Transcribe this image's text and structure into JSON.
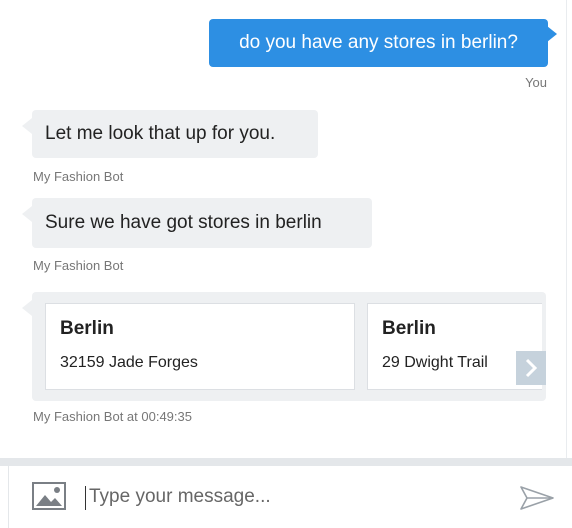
{
  "messages": {
    "user": {
      "text": "do you have any stores in berlin?",
      "sender": "You"
    },
    "bot1": {
      "text": "Let me look that up for you.",
      "sender": "My Fashion Bot"
    },
    "bot2": {
      "text": "Sure we have got stores in berlin",
      "sender": "My Fashion Bot"
    }
  },
  "carousel": {
    "cards": [
      {
        "title": "Berlin",
        "address": "32159 Jade Forges"
      },
      {
        "title": "Berlin",
        "address": "29 Dwight Trail"
      }
    ],
    "next_icon": "chevron-right-icon",
    "sender": "My Fashion Bot at 00:49:35"
  },
  "composer": {
    "placeholder": "Type your message...",
    "image_icon": "image-icon",
    "send_icon": "send-icon"
  },
  "colors": {
    "user_bubble": "#2d8fe3",
    "bot_bubble": "#eef0f2",
    "next_button": "#c6d2dc"
  }
}
